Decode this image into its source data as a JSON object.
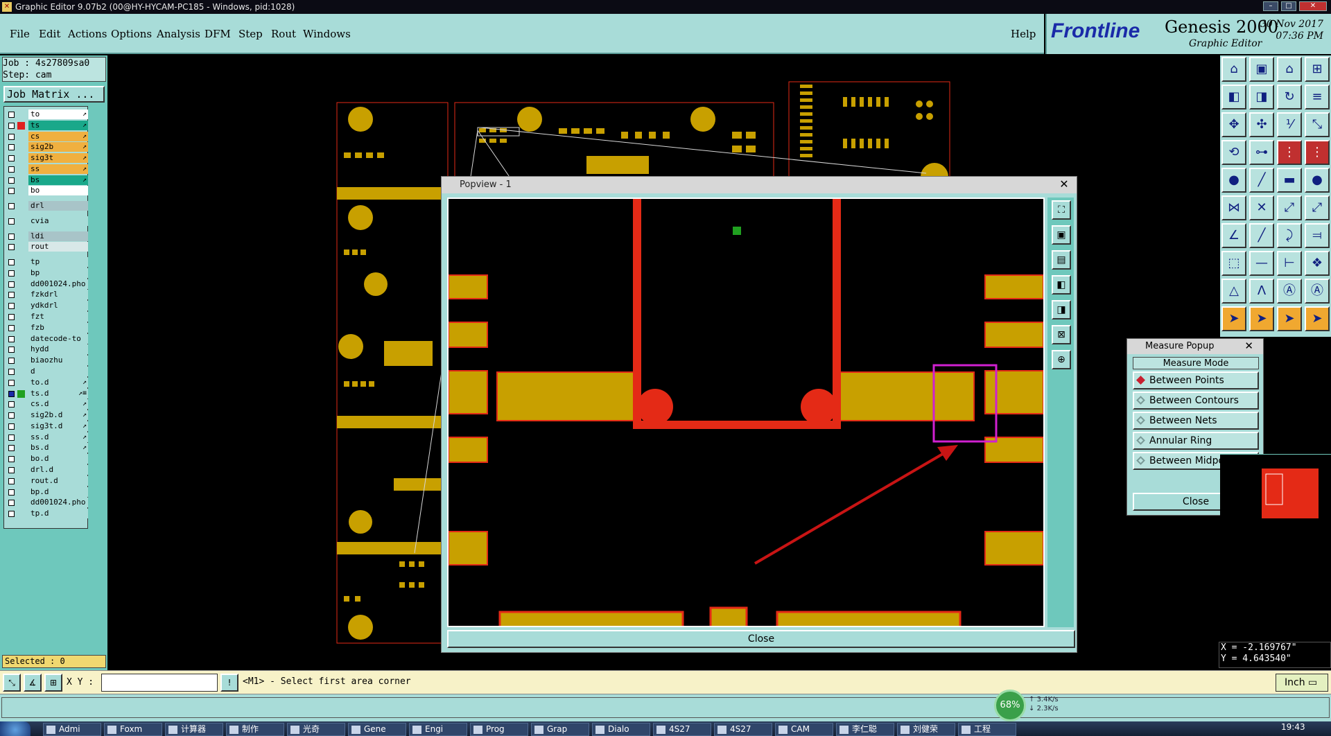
{
  "window": {
    "title": "Graphic Editor 9.07b2 (00@HY-HYCAM-PC185 - Windows, pid:1028)"
  },
  "menu": {
    "items": [
      "File",
      "Edit",
      "Actions",
      "Options",
      "Analysis",
      "DFM",
      "Step",
      "Rout",
      "Windows"
    ],
    "help": "Help"
  },
  "brand": {
    "frontline": "Frontline",
    "product": "Genesis 2000",
    "subtitle": "Graphic Editor",
    "date": "30 Nov 2017",
    "time": "07:36 PM"
  },
  "job": {
    "job_line": "Job : 4s27809sa0",
    "step_line": "Step: cam",
    "matrix_button": "Job Matrix ..."
  },
  "layers": [
    {
      "name": "to",
      "bg": "#ffffff",
      "swatch": "",
      "arrow": "↗"
    },
    {
      "name": "ts",
      "bg": "#1aa88a",
      "swatch": "#e02020",
      "arrow": "↗"
    },
    {
      "name": "cs",
      "bg": "#f0b040",
      "swatch": "",
      "arrow": "↗"
    },
    {
      "name": "sig2b",
      "bg": "#f0b040",
      "swatch": "",
      "arrow": "↗"
    },
    {
      "name": "sig3t",
      "bg": "#f0b040",
      "swatch": "",
      "arrow": "↗"
    },
    {
      "name": "ss",
      "bg": "#f0b040",
      "swatch": "",
      "arrow": "↗"
    },
    {
      "name": "bs",
      "bg": "#1aa88a",
      "swatch": "",
      "arrow": "↗"
    },
    {
      "name": "bo",
      "bg": "#ffffff",
      "swatch": "",
      "arrow": ""
    },
    {
      "name": "drl",
      "bg": "#a8c4c8",
      "swatch": "",
      "arrow": ""
    },
    {
      "name": "cvia",
      "bg": "#a8dcd8",
      "swatch": "",
      "arrow": ""
    },
    {
      "name": "ldi",
      "bg": "#a8c4c8",
      "swatch": "",
      "arrow": ""
    },
    {
      "name": "rout",
      "bg": "#d8e8e8",
      "swatch": "",
      "arrow": ""
    },
    {
      "name": "tp",
      "bg": "#a8dcd8",
      "swatch": "",
      "arrow": ""
    },
    {
      "name": "bp",
      "bg": "#a8dcd8",
      "swatch": "",
      "arrow": ""
    },
    {
      "name": "dd001024.pho",
      "bg": "#a8dcd8",
      "swatch": "",
      "arrow": ""
    },
    {
      "name": "fzkdrl",
      "bg": "#a8dcd8",
      "swatch": "",
      "arrow": ""
    },
    {
      "name": "ydkdrl",
      "bg": "#a8dcd8",
      "swatch": "",
      "arrow": ""
    },
    {
      "name": "fzt",
      "bg": "#a8dcd8",
      "swatch": "",
      "arrow": ""
    },
    {
      "name": "fzb",
      "bg": "#a8dcd8",
      "swatch": "",
      "arrow": ""
    },
    {
      "name": "datecode-to",
      "bg": "#a8dcd8",
      "swatch": "",
      "arrow": ""
    },
    {
      "name": "hydd",
      "bg": "#a8dcd8",
      "swatch": "",
      "arrow": ""
    },
    {
      "name": "biaozhu",
      "bg": "#a8dcd8",
      "swatch": "",
      "arrow": ""
    },
    {
      "name": "d",
      "bg": "#a8dcd8",
      "swatch": "",
      "arrow": ""
    },
    {
      "name": "to.d",
      "bg": "#a8dcd8",
      "swatch": "",
      "arrow": "↗"
    },
    {
      "name": "ts.d",
      "bg": "#a8dcd8",
      "swatch": "#20a020",
      "arrow": "↗≡"
    },
    {
      "name": "cs.d",
      "bg": "#a8dcd8",
      "swatch": "",
      "arrow": "↗"
    },
    {
      "name": "sig2b.d",
      "bg": "#a8dcd8",
      "swatch": "",
      "arrow": "↗"
    },
    {
      "name": "sig3t.d",
      "bg": "#a8dcd8",
      "swatch": "",
      "arrow": "↗"
    },
    {
      "name": "ss.d",
      "bg": "#a8dcd8",
      "swatch": "",
      "arrow": "↗"
    },
    {
      "name": "bs.d",
      "bg": "#a8dcd8",
      "swatch": "",
      "arrow": "↗"
    },
    {
      "name": "bo.d",
      "bg": "#a8dcd8",
      "swatch": "",
      "arrow": ""
    },
    {
      "name": "drl.d",
      "bg": "#a8dcd8",
      "swatch": "",
      "arrow": ""
    },
    {
      "name": "rout.d",
      "bg": "#a8dcd8",
      "swatch": "",
      "arrow": ""
    },
    {
      "name": "bp.d",
      "bg": "#a8dcd8",
      "swatch": "",
      "arrow": ""
    },
    {
      "name": "dd001024.pho",
      "bg": "#a8dcd8",
      "swatch": "",
      "arrow": ""
    },
    {
      "name": "tp.d",
      "bg": "#a8dcd8",
      "swatch": "",
      "arrow": ""
    }
  ],
  "selected": "Selected : 0",
  "popview": {
    "title": "Popview - 1",
    "close_label": "Close",
    "close_x": "✕"
  },
  "measure": {
    "title": "Measure Popup",
    "heading": "Measure Mode",
    "close_x": "✕",
    "options": [
      {
        "label": "Between Points",
        "selected": true
      },
      {
        "label": "Between Contours",
        "selected": false
      },
      {
        "label": "Between Nets",
        "selected": false
      },
      {
        "label": "Annular Ring",
        "selected": false
      },
      {
        "label": "Between Midpoints",
        "selected": false
      }
    ],
    "close_label": "Close"
  },
  "coords": {
    "x": "X = -2.169767\"",
    "y": "Y = 4.643540\""
  },
  "cmd": {
    "xy_label": "X Y :",
    "input_value": "",
    "prompt": "<M1> - Select first area corner",
    "units": "Inch"
  },
  "net": {
    "percent": "68%",
    "up": "3.4K/s",
    "down": "2.3K/s"
  },
  "taskbar": {
    "items": [
      "Admi",
      "Foxm",
      "计算器",
      "制作",
      "光奇",
      "Gene",
      "Engi",
      "Prog",
      "Grap",
      "Dialo",
      "4S27",
      "4S27",
      "CAM",
      "李仁聪",
      "刘健荣",
      "工程"
    ],
    "clock": "19:43"
  },
  "colors": {
    "copper": "#c8a000",
    "highlight_red": "#e42a16",
    "panel": "#a8dcd8",
    "panel_dark": "#6ec8bc",
    "measure_box": "#d020d0"
  },
  "icons": {
    "toolbar": [
      "home-icon",
      "zoom-icon",
      "select-icon",
      "measure-icon",
      "line-icon",
      "arc-icon",
      "pad-icon",
      "cursor-icon"
    ]
  }
}
